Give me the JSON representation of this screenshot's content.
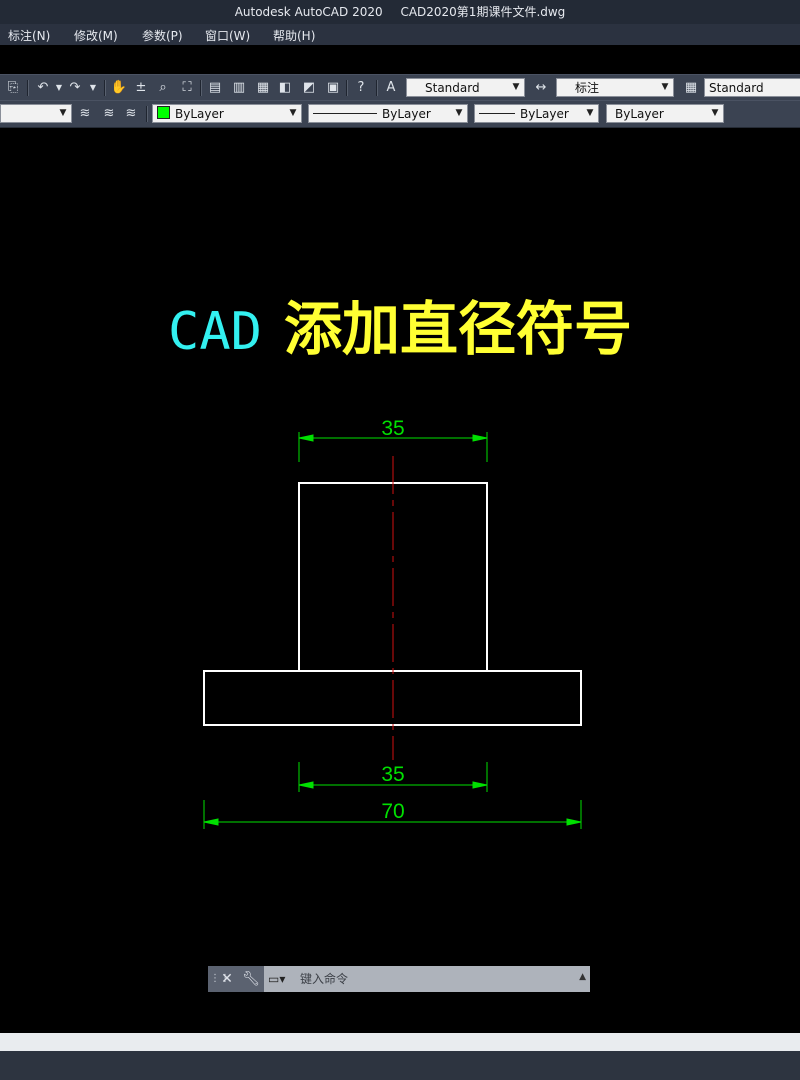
{
  "window": {
    "app_title": "Autodesk AutoCAD 2020",
    "file_name": "CAD2020第1期课件文件.dwg"
  },
  "menu": [
    "标注(N)",
    "修改(M)",
    "参数(P)",
    "窗口(W)",
    "帮助(H)"
  ],
  "toolbar1": {
    "text_style": "Standard",
    "dim_style": "标注",
    "table_style": "Standard"
  },
  "toolbar2": {
    "color": "ByLayer",
    "linetype": "ByLayer",
    "lineweight": "ByLayer",
    "plot_style": "ByLayer",
    "color_swatch": "#00ff00"
  },
  "drawing": {
    "heading_prefix": "CAD",
    "heading_text": "添加直径符号",
    "dimensions": {
      "top_width": "35",
      "bottom_inner_width": "35",
      "overall_width": "70"
    },
    "colors": {
      "outline": "#ffffff",
      "dimension": "#00e000",
      "centerline": "#d01010",
      "heading_prefix": "#33f0f0",
      "heading_text": "#ffff33"
    }
  },
  "command_line": {
    "placeholder": "键入命令"
  },
  "icons": [
    "close-icon",
    "wrench-icon",
    "command-prompt-icon",
    "pan-hand-icon",
    "zoom-icon",
    "help-icon",
    "undo-icon",
    "redo-icon",
    "text-style-icon",
    "dim-style-icon",
    "table-style-icon",
    "layer-icon"
  ]
}
